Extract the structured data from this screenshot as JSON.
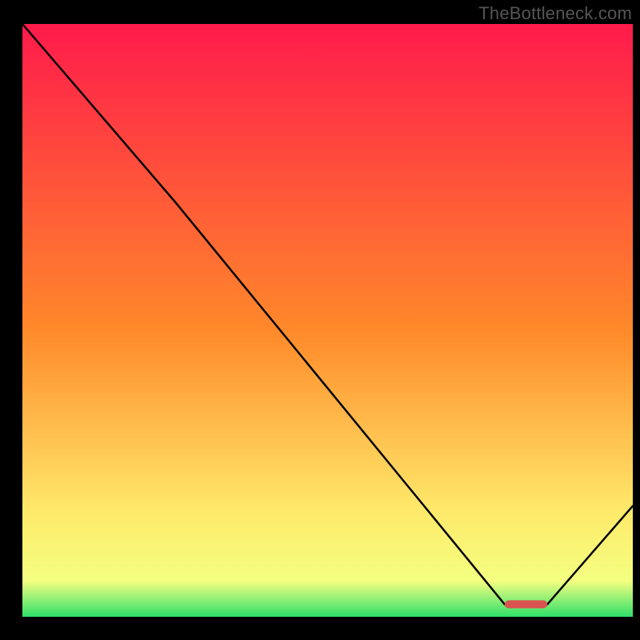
{
  "watermark": "TheBottleneck.com",
  "colors": {
    "curve": "#000000",
    "marker": "#d9534f",
    "gradient_top": "#ff1a4b",
    "gradient_mid_high": "#ff8a2a",
    "gradient_mid_low": "#ffe96a",
    "gradient_yellowgreen": "#f4ff80",
    "gradient_bottom": "#2fe06a"
  },
  "chart_data": {
    "type": "line",
    "title": "",
    "xlabel": "",
    "ylabel": "",
    "xlim": [
      0,
      100
    ],
    "ylim": [
      0,
      100
    ],
    "grid": false,
    "legend": false,
    "series": [
      {
        "name": "curve",
        "x": [
          0,
          25,
          79,
          86,
          100
        ],
        "y": [
          100,
          70,
          2.1,
          2.1,
          18.7
        ]
      }
    ],
    "marker": {
      "x_start": 79,
      "x_end": 86,
      "y": 2.1
    },
    "gradient_stops": [
      {
        "pos": 0.0,
        "key": "gradient_top"
      },
      {
        "pos": 0.52,
        "key": "gradient_mid_high"
      },
      {
        "pos": 0.82,
        "key": "gradient_mid_low"
      },
      {
        "pos": 0.94,
        "key": "gradient_yellowgreen"
      },
      {
        "pos": 1.0,
        "key": "gradient_bottom"
      }
    ]
  }
}
